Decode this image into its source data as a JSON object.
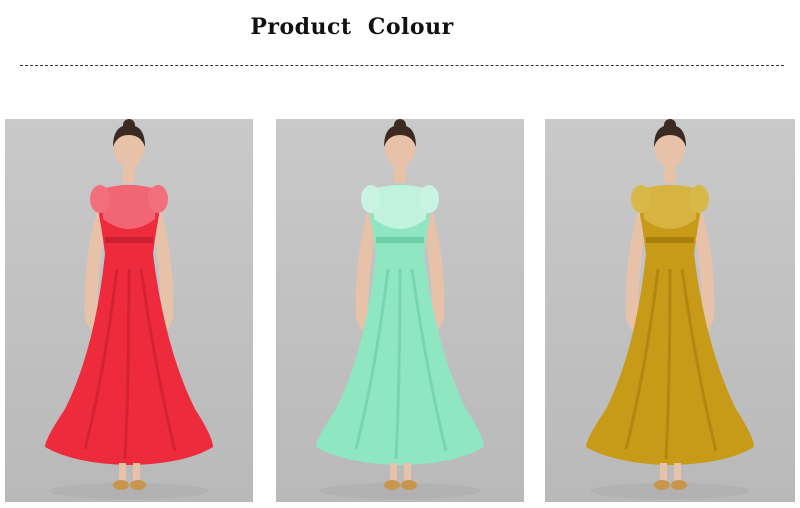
{
  "header": {
    "title": "Product  Colour"
  },
  "products": [
    {
      "color": "#ee2a3d",
      "shade": "#c91f30",
      "lace": "#f2707c"
    },
    {
      "color": "#8fe6c2",
      "shade": "#6ccfa6",
      "lace": "#c9f3e3"
    },
    {
      "color": "#c79a18",
      "shade": "#a97f0d",
      "lace": "#d9b84a"
    }
  ]
}
